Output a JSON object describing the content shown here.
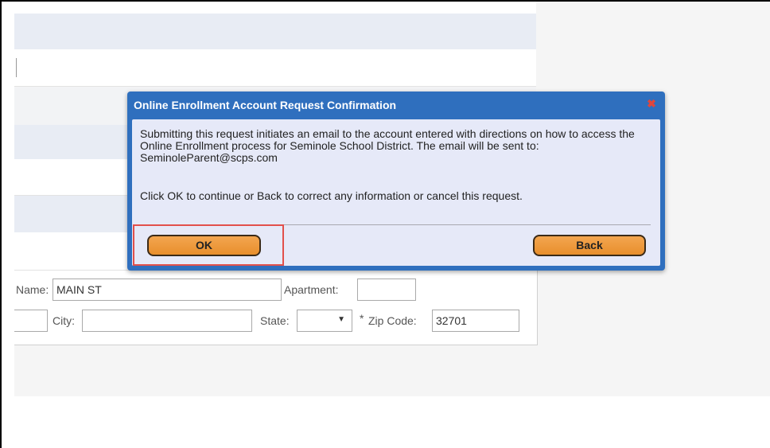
{
  "dialog": {
    "title": "Online Enrollment Account Request Confirmation",
    "message": "Submitting this request initiates an email to the account entered with directions on how to access the Online Enrollment process for Seminole School District. The email will be sent to: SeminoleParent@scps.com",
    "instruction": "Click OK to continue or Back to correct any information or cancel this request.",
    "ok_label": "OK",
    "back_label": "Back",
    "close_glyph": "✖"
  },
  "address": {
    "name_label": "Name:",
    "name_value": "MAIN ST",
    "apartment_label": "Apartment:",
    "apartment_value": "",
    "city_label": "City:",
    "city_value": "",
    "state_label": "State:",
    "state_value": "",
    "required_mark": "*",
    "zip_label": "Zip Code:",
    "zip_value": "32701"
  },
  "colors": {
    "dialog_header": "#2f6fbe",
    "dialog_body": "#e6e9f8",
    "button": "#e88f2c",
    "highlight": "#e2504b"
  }
}
